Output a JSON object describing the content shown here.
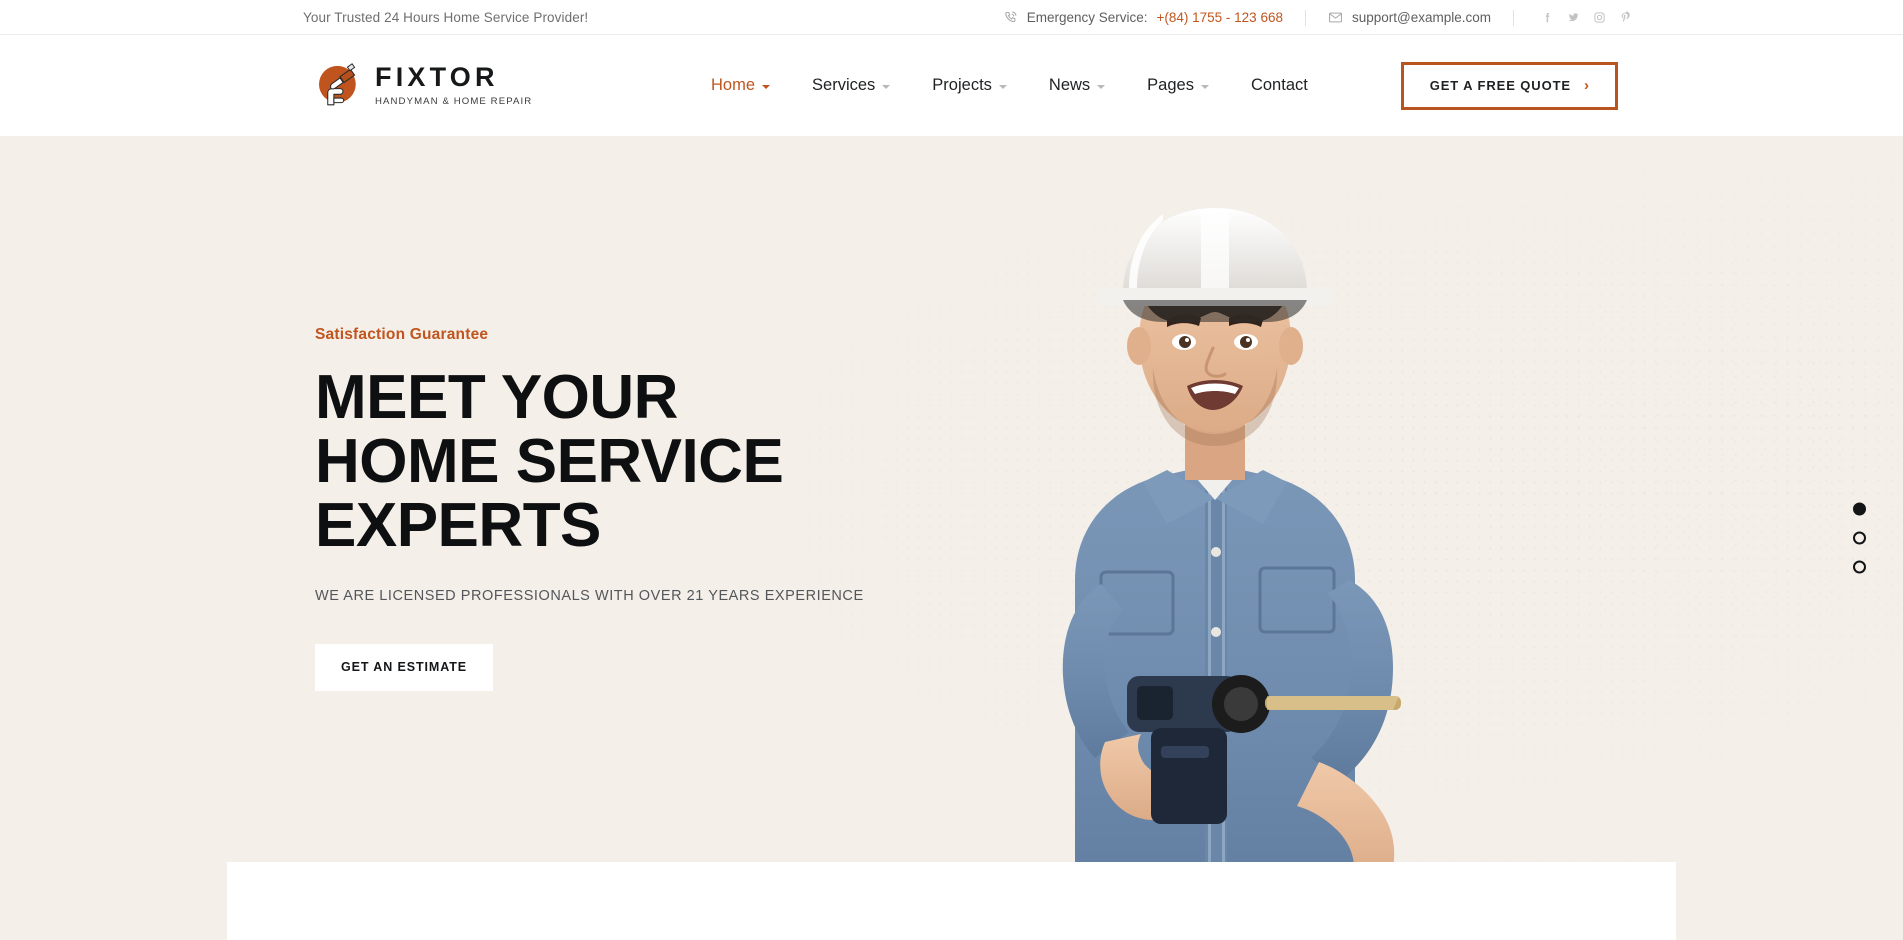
{
  "topbar": {
    "tagline": "Your Trusted 24 Hours Home Service Provider!",
    "phone_label": "Emergency Service:",
    "phone_number": "+(84) 1755 - 123 668",
    "email": "support@example.com",
    "socials": [
      "facebook-icon",
      "twitter-icon",
      "instagram-icon",
      "pinterest-icon"
    ]
  },
  "header": {
    "logo_title": "FIXTOR",
    "logo_subtitle": "HANDYMAN & HOME REPAIR",
    "nav": [
      {
        "label": "Home",
        "has_dropdown": true,
        "active": true
      },
      {
        "label": "Services",
        "has_dropdown": true,
        "active": false
      },
      {
        "label": "Projects",
        "has_dropdown": true,
        "active": false
      },
      {
        "label": "News",
        "has_dropdown": true,
        "active": false
      },
      {
        "label": "Pages",
        "has_dropdown": true,
        "active": false
      },
      {
        "label": "Contact",
        "has_dropdown": false,
        "active": false
      }
    ],
    "quote_button": "GET A FREE QUOTE",
    "quote_arrow": "›"
  },
  "hero": {
    "eyebrow": "Satisfaction Guarantee",
    "title_line1": "MEET YOUR",
    "title_line2": "HOME SERVICE",
    "title_line3": "EXPERTS",
    "subtitle": "WE ARE LICENSED PROFESSIONALS WITH OVER 21 YEARS EXPERIENCE",
    "cta": "GET AN ESTIMATE",
    "slides": [
      {
        "index": 1,
        "active": true
      },
      {
        "index": 2,
        "active": false
      },
      {
        "index": 3,
        "active": false
      }
    ]
  },
  "colors": {
    "accent": "#C0551F",
    "hero_bg": "#F4EFE8",
    "text_dark": "#0E0F10",
    "text_muted": "#6A6A6A"
  }
}
